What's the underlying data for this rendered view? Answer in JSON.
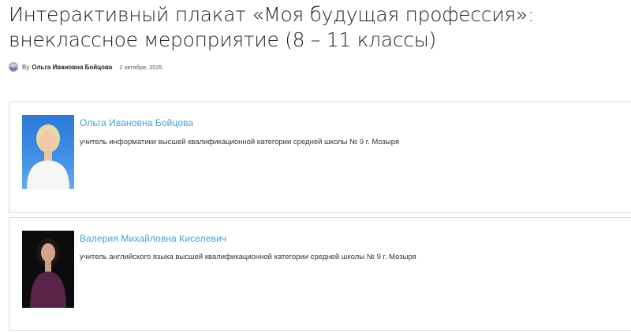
{
  "page": {
    "title": "Интерактивный плакат «Моя будущая профессия»: внеклассное мероприятие (8 – 11 классы)"
  },
  "meta": {
    "by": "By",
    "author": "Ольга Ивановна Бойцова",
    "date": "2 октября, 2025"
  },
  "authors": [
    {
      "name": "Ольга Ивановна Бойцова",
      "position": "учитель информатики высшей квалификационной категории средней школы № 9 г. Мозыря"
    },
    {
      "name": "Валерия Михайловна Киселевич",
      "position": "учитель английского языка высшей квалификационной категории средней школы № 9 г. Мозыря"
    }
  ]
}
